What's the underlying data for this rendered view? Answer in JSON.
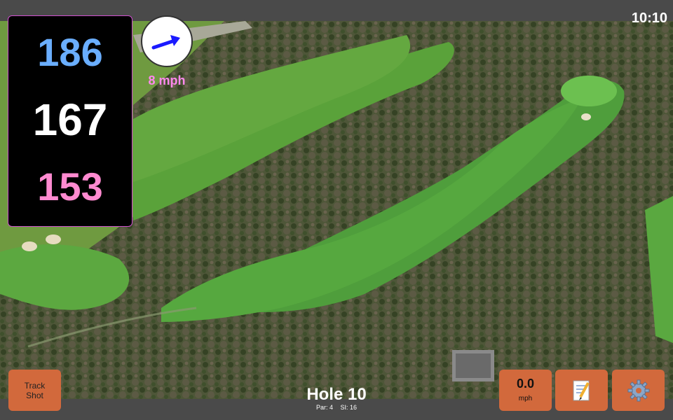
{
  "clock": "10:10",
  "distances": {
    "back": "186",
    "middle": "167",
    "front": "153"
  },
  "wind": {
    "speed_label": "8 mph",
    "direction_icon": "wind-arrow-icon"
  },
  "buttons": {
    "track_shot_label": "Track\nShot",
    "wind_value": "0.0",
    "wind_unit": "mph",
    "notes_icon": "notes-icon",
    "settings_icon": "gear-icon"
  },
  "hole": {
    "title": "Hole 10",
    "par": "Par: 4",
    "si": "SI: 16"
  },
  "colors": {
    "back_distance": "#6aaeff",
    "middle_distance": "#ffffff",
    "front_distance": "#ff8ad0",
    "wind_speed": "#ff88ee",
    "button": "#d2693c",
    "arrow": "#1a1aff"
  }
}
